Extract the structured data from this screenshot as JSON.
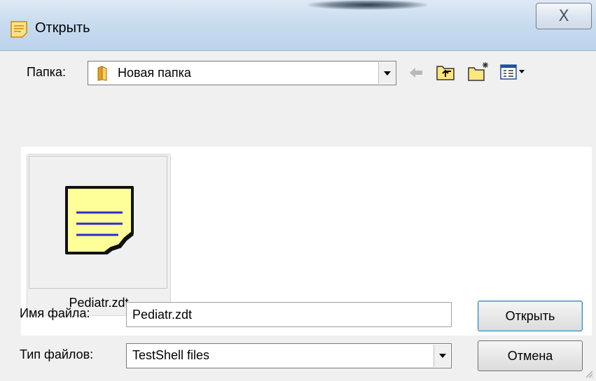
{
  "window": {
    "title": "Открыть",
    "close_glyph": "X"
  },
  "toolbar": {
    "folder_label": "Папка:",
    "folder_value": "Новая папка",
    "icons": [
      "back-arrow-icon",
      "up-folder-icon",
      "new-folder-icon",
      "view-menu-icon"
    ]
  },
  "files": [
    {
      "name": "Pediatr.zdt",
      "icon": "note-document-icon"
    }
  ],
  "form": {
    "filename_label": "Имя файла:",
    "filename_value": "Pediatr.zdt",
    "filetype_label": "Тип файлов:",
    "filetype_value": "TestShell files"
  },
  "buttons": {
    "open_label": "Открыть",
    "cancel_label": "Отмена"
  },
  "colors": {
    "note_fill": "#ffff99",
    "note_lines": "#2d2dc8",
    "folder_yellow": "#f2c94c"
  }
}
